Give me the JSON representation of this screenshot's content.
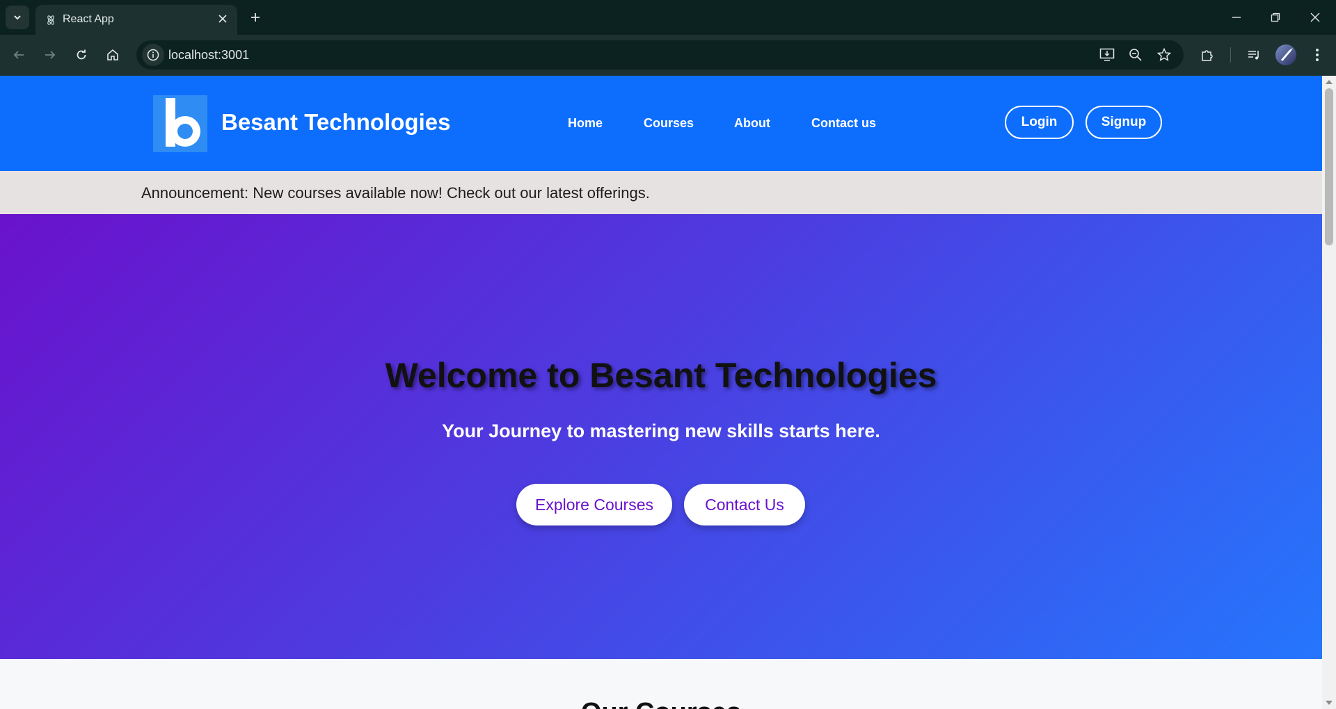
{
  "browser": {
    "tab_title": "React App",
    "url": "localhost:3001"
  },
  "header": {
    "brand": "Besant Technologies",
    "logo_letter": "b",
    "nav": [
      {
        "label": "Home"
      },
      {
        "label": "Courses"
      },
      {
        "label": "About"
      },
      {
        "label": "Contact us"
      }
    ],
    "login_label": "Login",
    "signup_label": "Signup"
  },
  "announcement": {
    "text": "Announcement: New courses available now! Check out our latest offerings."
  },
  "hero": {
    "title": "Welcome to Besant Technologies",
    "subtitle": "Your Journey to mastering new skills starts here.",
    "explore_label": "Explore Courses",
    "contact_label": "Contact Us"
  },
  "courses": {
    "heading": "Our Courses"
  },
  "colors": {
    "header_blue": "#0d6efd",
    "hero_start": "#6a12cc",
    "hero_end": "#2576fc",
    "announcement_bg": "#e7e2e2"
  }
}
